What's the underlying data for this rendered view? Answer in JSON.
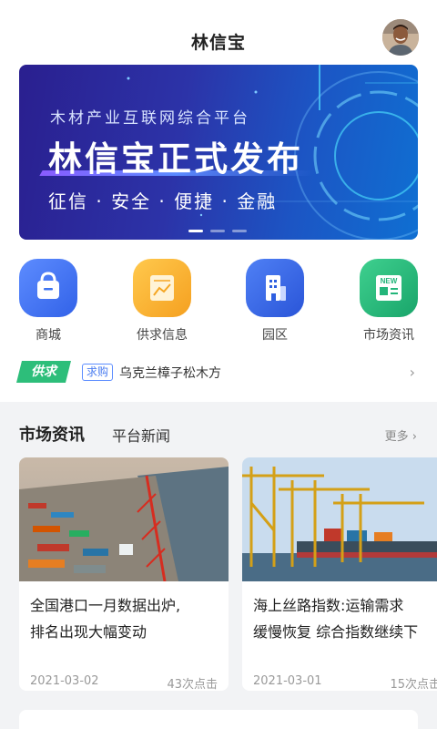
{
  "header": {
    "title": "林信宝"
  },
  "banner": {
    "subtitle": "木材产业互联网综合平台",
    "title": "林信宝正式发布",
    "tagline": "征信 · 安全 · 便捷 · 金融"
  },
  "quicknav": [
    {
      "label": "商城",
      "icon": "shopping-bag-icon",
      "color": "#3d73f0"
    },
    {
      "label": "供求信息",
      "icon": "chart-card-icon",
      "color": "#f5a623"
    },
    {
      "label": "园区",
      "icon": "building-icon",
      "color": "#2f5fe0"
    },
    {
      "label": "市场资讯",
      "icon": "news-icon",
      "color": "#23b57a"
    }
  ],
  "ticker": {
    "logo": "供求",
    "tag": "求购",
    "text": "乌克兰樟子松木方"
  },
  "news": {
    "tab_active": "市场资讯",
    "tab_inactive": "平台新闻",
    "more": "更多",
    "items": [
      {
        "title_line1": "全国港口一月数据出炉,",
        "title_line2": "排名出现大幅变动",
        "date": "2021-03-02",
        "clicks": "43次点击"
      },
      {
        "title_line1": "海上丝路指数:运输需求",
        "title_line2": "缓慢恢复 综合指数继续下",
        "date": "2021-03-01",
        "clicks": "15次点击"
      }
    ]
  }
}
